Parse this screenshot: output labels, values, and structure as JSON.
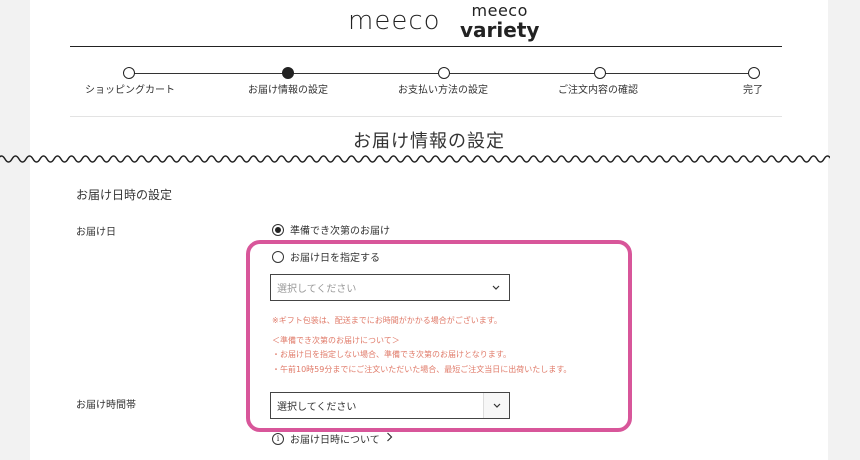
{
  "header": {
    "logo_primary": "meeco",
    "logo_secondary_top": "meeco",
    "logo_secondary_bottom": "variety"
  },
  "steps": [
    {
      "label": "ショッピングカート",
      "active": false
    },
    {
      "label": "お届け情報の設定",
      "active": true
    },
    {
      "label": "お支払い方法の設定",
      "active": false
    },
    {
      "label": "ご注文内容の確認",
      "active": false
    },
    {
      "label": "完了",
      "active": false
    }
  ],
  "page_title": "お届け情報の設定",
  "section": {
    "title": "お届け日時の設定",
    "delivery_date_label": "お届け日",
    "option_asap": "準備でき次第のお届け",
    "option_specify": "お届け日を指定する",
    "date_select_placeholder": "選択してください",
    "notes": [
      "※ギフト包装は、配送までにお時間がかかる場合がございます。",
      "＜準備でき次第のお届けについて＞",
      "・お届け日を指定しない場合、準備でき次第のお届けとなります。",
      "・午前10時59分までにご注文いただいた場合、最短ご注文当日に出荷いたします。"
    ],
    "delivery_time_label": "お届け時間帯",
    "time_select_value": "選択してください",
    "about_link": "お届け日時について"
  },
  "colors": {
    "highlight": "#d8569a",
    "note": "#e07b6a"
  }
}
